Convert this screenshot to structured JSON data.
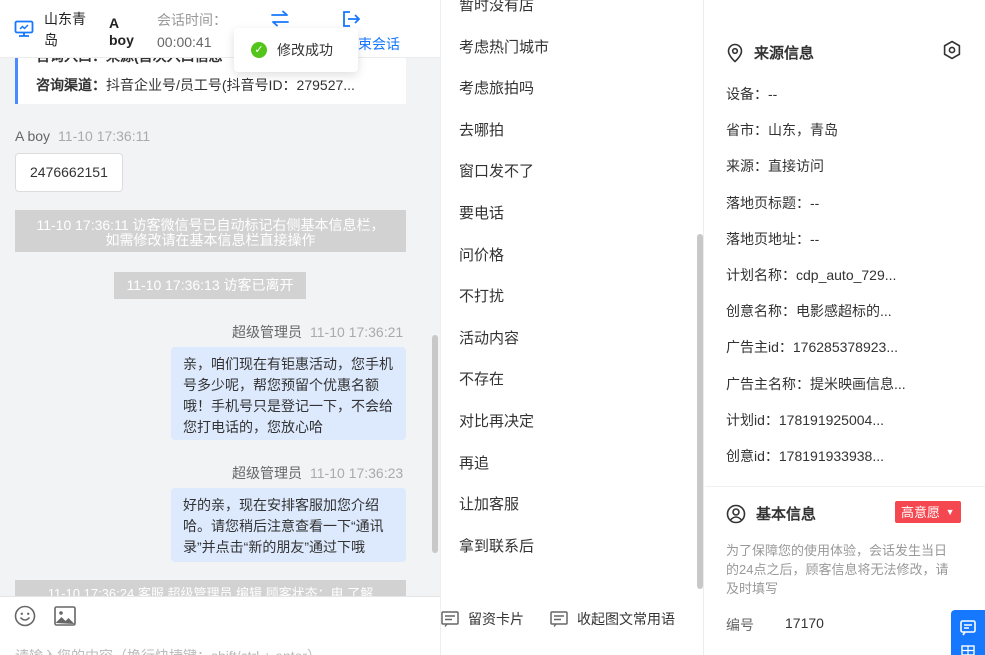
{
  "visitor": {
    "location": "山东青岛",
    "name": "A boy",
    "session_time_label": "会话时间：",
    "session_time": "00:00:41",
    "end_session_label": "束会话"
  },
  "toast": {
    "text": "修改成功"
  },
  "info_card": {
    "row1": "咨询入口：来源(首次入口信息",
    "row2_label": "咨询渠道：",
    "row2_value": "抖音企业号/员工号(抖音号ID：279527..."
  },
  "messages": {
    "visitor_name": "A boy",
    "visitor_time": "11-10 17:36:11",
    "visitor_text": "2476662151",
    "sys1_line1": "11-10 17:36:11 访客微信号已自动标记右侧基本信息栏，",
    "sys1_line2": "如需修改请在基本信息栏直接操作",
    "sys2": "11-10 17:36:13 访客已离开",
    "agent1_name": "超级管理员",
    "agent1_time": "11-10 17:36:21",
    "agent1_text": "亲，咱们现在有钜惠活动，您手机号多少呢，帮您预留个优惠名额哦！手机号只是登记一下，不会给您打电话的，您放心哈",
    "agent2_name": "超级管理员",
    "agent2_time": "11-10 17:36:23",
    "agent2_text": "好的亲，现在安排客服加您介绍哈。请您稍后注意查看一下“通讯录”并点击“新的朋友”通过下哦",
    "sys3_cut": "11-10 17:36:24 客服 超级管理员 编辑 顾客状态：电 了解"
  },
  "composer": {
    "placeholder": "请输入您的内容（换行快捷键：shift/ctrl + enter）"
  },
  "quick_replies": {
    "items": [
      "暂时没有店",
      "考虑热门城市",
      "考虑旅拍吗",
      "去哪拍",
      "窗口发不了",
      "要电话",
      "问价格",
      "不打扰",
      "活动内容",
      "不存在",
      "对比再决定",
      "再追",
      "让加客服",
      "拿到联系后"
    ],
    "card_button": "留资卡片",
    "collapse_button": "收起图文常用语"
  },
  "source": {
    "title": "来源信息",
    "fields": [
      "设备：--",
      "省市：山东，青岛",
      "来源：直接访问",
      "落地页标题：--",
      "落地页地址：--",
      "计划名称：cdp_auto_729...",
      "创意名称：电影感超标的...",
      "广告主id：176285378923...",
      "广告主名称：提米映画信息...",
      "计划id：178191925004...",
      "创意id：178191933938..."
    ]
  },
  "basic": {
    "title": "基本信息",
    "intent": "高意愿",
    "note": "为了保障您的使用体验，会话发生当日的24点之后，顾客信息将无法修改，请及时填写",
    "number_label": "编号",
    "number_value": "17170"
  },
  "colors": {
    "accent": "#1677ff",
    "agent_bubble": "#dde9fd",
    "intent_badge": "#f5474f",
    "success": "#52c41a"
  }
}
